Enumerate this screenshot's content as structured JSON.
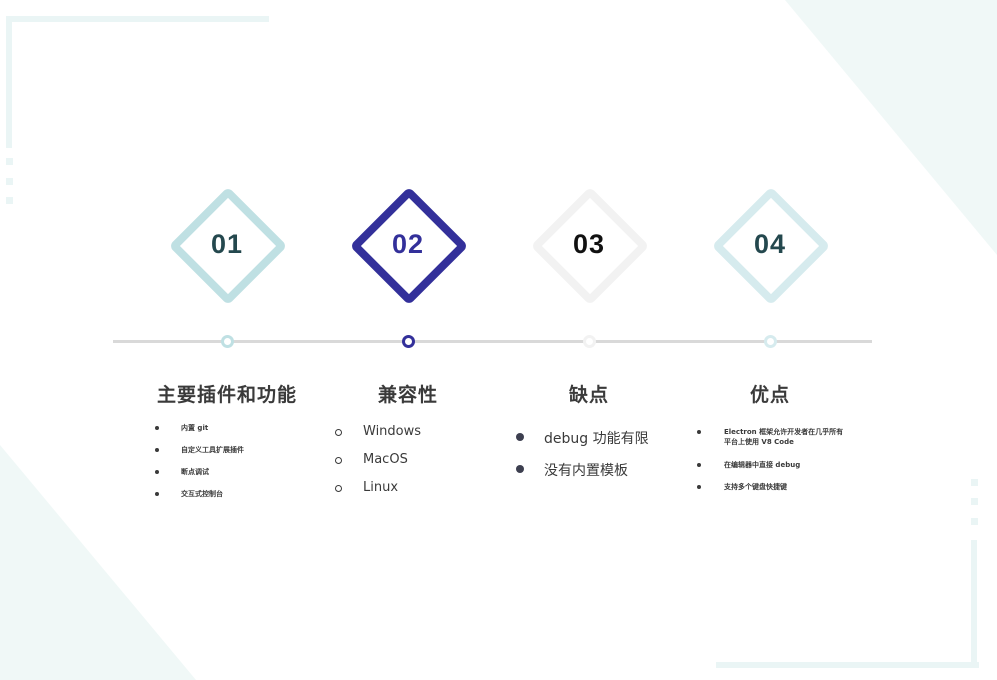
{
  "steps": [
    {
      "number": "01",
      "title": "主要插件和功能",
      "color": "#bfe0e3",
      "number_color": "#24484e",
      "bullet_style": "small-dot",
      "items": [
        "内置 git",
        "自定义工具扩展插件",
        "断点调试",
        "交互式控制台"
      ]
    },
    {
      "number": "02",
      "title": "兼容性",
      "color": "#33309a",
      "number_color": "#33309a",
      "bullet_style": "hollow-circle",
      "items": [
        "Windows",
        "MacOS",
        "Linux"
      ]
    },
    {
      "number": "03",
      "title": "缺点",
      "color": "#f2f2f2",
      "number_color": "#111111",
      "bullet_style": "filled-dot",
      "items": [
        "debug 功能有限",
        "没有内置模板"
      ]
    },
    {
      "number": "04",
      "title": "优点",
      "color": "#d6ebee",
      "number_color": "#24484e",
      "bullet_style": "small-dot",
      "items": [
        "Electron 框架允许开发者在几乎所有平台上使用 V8 Code",
        "在编辑器中直接 debug",
        "支持多个键盘快捷键"
      ]
    }
  ],
  "colors": {
    "timeline": "#d9d9d9",
    "decor": "#eaf5f5",
    "title_text": "#3a3a3a",
    "body_text": "#3a3a3a"
  }
}
